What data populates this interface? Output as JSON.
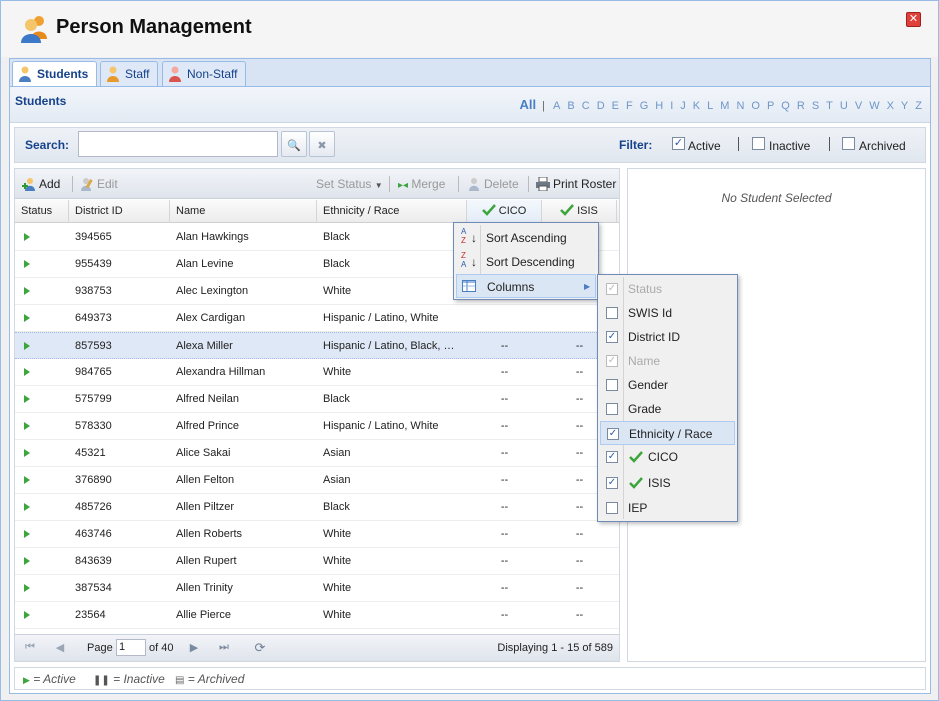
{
  "app": {
    "title": "Person Management",
    "close_label": "✕"
  },
  "tabs": [
    {
      "label": "Students",
      "active": true,
      "color": "#4a7ec2"
    },
    {
      "label": "Staff",
      "active": false,
      "color": "#e69a2a"
    },
    {
      "label": "Non-Staff",
      "active": false,
      "color": "#d9534f"
    }
  ],
  "section": {
    "title": "Students"
  },
  "alphabet": {
    "all": "All",
    "separator": "|",
    "letters": [
      "A",
      "B",
      "C",
      "D",
      "E",
      "F",
      "G",
      "H",
      "I",
      "J",
      "K",
      "L",
      "M",
      "N",
      "O",
      "P",
      "Q",
      "R",
      "S",
      "T",
      "U",
      "V",
      "W",
      "X",
      "Y",
      "Z"
    ]
  },
  "search": {
    "label": "Search:",
    "value": "",
    "placeholder": "",
    "search_icon": "🔍",
    "clear_icon": "✖"
  },
  "filter": {
    "label": "Filter:",
    "options": [
      {
        "label": "Active",
        "checked": true
      },
      {
        "label": "Inactive",
        "checked": false
      },
      {
        "label": "Archived",
        "checked": false
      }
    ]
  },
  "toolbar": {
    "add": "Add",
    "edit": "Edit",
    "set_status": "Set Status",
    "merge": "Merge",
    "delete": "Delete",
    "print_roster": "Print Roster"
  },
  "columns": {
    "status": "Status",
    "district_id": "District ID",
    "name": "Name",
    "ethnicity": "Ethnicity / Race",
    "cico": "CICO",
    "isis": "ISIS"
  },
  "rows": [
    {
      "id": "394565",
      "name": "Alan Hawkings",
      "eth": "Black",
      "cico": "",
      "isis": ""
    },
    {
      "id": "955439",
      "name": "Alan Levine",
      "eth": "Black",
      "cico": "",
      "isis": ""
    },
    {
      "id": "938753",
      "name": "Alec Lexington",
      "eth": "White",
      "cico": "",
      "isis": ""
    },
    {
      "id": "649373",
      "name": "Alex Cardigan",
      "eth": "Hispanic / Latino, White",
      "cico": "",
      "isis": ""
    },
    {
      "id": "857593",
      "name": "Alexa Miller",
      "eth": "Hispanic / Latino, Black, Wh...",
      "cico": "--",
      "isis": "--"
    },
    {
      "id": "984765",
      "name": "Alexandra Hillman",
      "eth": "White",
      "cico": "--",
      "isis": "--"
    },
    {
      "id": "575799",
      "name": "Alfred Neilan",
      "eth": "Black",
      "cico": "--",
      "isis": "--"
    },
    {
      "id": "578330",
      "name": "Alfred Prince",
      "eth": "Hispanic / Latino, White",
      "cico": "--",
      "isis": "--"
    },
    {
      "id": "45321",
      "name": "Alice Sakai",
      "eth": "Asian",
      "cico": "--",
      "isis": "--"
    },
    {
      "id": "376890",
      "name": "Allen Felton",
      "eth": "Asian",
      "cico": "--",
      "isis": "--"
    },
    {
      "id": "485726",
      "name": "Allen Piltzer",
      "eth": "Black",
      "cico": "--",
      "isis": "--"
    },
    {
      "id": "463746",
      "name": "Allen Roberts",
      "eth": "White",
      "cico": "--",
      "isis": "--"
    },
    {
      "id": "843639",
      "name": "Allen Rupert",
      "eth": "White",
      "cico": "--",
      "isis": "--"
    },
    {
      "id": "387534",
      "name": "Allen Trinity",
      "eth": "White",
      "cico": "--",
      "isis": "--"
    },
    {
      "id": "23564",
      "name": "Allie Pierce",
      "eth": "White",
      "cico": "--",
      "isis": "--"
    }
  ],
  "pager": {
    "page_label": "Page",
    "page_value": "1",
    "of_label": "of 40",
    "displaying": "Displaying 1 - 15 of 589"
  },
  "detail": {
    "empty_message": "No Student Selected"
  },
  "legend": {
    "active": "= Active",
    "inactive": "= Inactive",
    "archived": "= Archived"
  },
  "header_menu": {
    "sort_asc": "Sort Ascending",
    "sort_desc": "Sort Descending",
    "columns": "Columns",
    "asc_icon_top": "A",
    "asc_icon_bottom": "Z",
    "desc_icon_top": "Z",
    "desc_icon_bottom": "A",
    "submenu_arrow": "▶"
  },
  "columns_menu": [
    {
      "label": "Status",
      "checked": true,
      "disabled": true,
      "icon": ""
    },
    {
      "label": "SWIS Id",
      "checked": false,
      "disabled": false,
      "icon": ""
    },
    {
      "label": "District ID",
      "checked": true,
      "disabled": false,
      "icon": ""
    },
    {
      "label": "Name",
      "checked": true,
      "disabled": true,
      "icon": ""
    },
    {
      "label": "Gender",
      "checked": false,
      "disabled": false,
      "icon": ""
    },
    {
      "label": "Grade",
      "checked": false,
      "disabled": false,
      "icon": ""
    },
    {
      "label": "Ethnicity / Race",
      "checked": true,
      "disabled": false,
      "icon": "",
      "highlight": true
    },
    {
      "label": "CICO",
      "checked": true,
      "disabled": false,
      "icon": "check-icon"
    },
    {
      "label": "ISIS",
      "checked": true,
      "disabled": false,
      "icon": "check-icon"
    },
    {
      "label": "IEP",
      "checked": false,
      "disabled": false,
      "icon": ""
    }
  ],
  "check_mark": "✓",
  "colors": {
    "accent": "#15428b",
    "active_green": "#3ca53c",
    "border": "#99bbe8"
  }
}
